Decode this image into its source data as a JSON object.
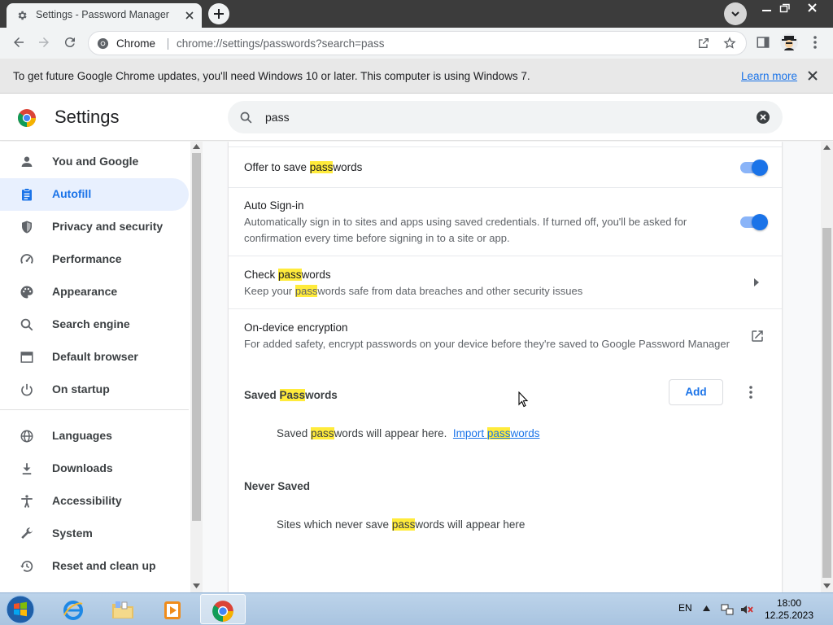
{
  "tab": {
    "title": "Settings - Password Manager"
  },
  "omnibox": {
    "site_name": "Chrome",
    "url": "chrome://settings/passwords?search=pass"
  },
  "infobar": {
    "message": "To get future Google Chrome updates, you'll need Windows 10 or later. This computer is using Windows 7.",
    "learn_more": "Learn more"
  },
  "header": {
    "title": "Settings",
    "search_query": "pass"
  },
  "sidebar": {
    "items": [
      {
        "label": "You and Google",
        "icon": "person-icon"
      },
      {
        "label": "Autofill",
        "icon": "clipboard-icon",
        "active": true
      },
      {
        "label": "Privacy and security",
        "icon": "shield-icon"
      },
      {
        "label": "Performance",
        "icon": "speedometer-icon"
      },
      {
        "label": "Appearance",
        "icon": "palette-icon"
      },
      {
        "label": "Search engine",
        "icon": "search-icon"
      },
      {
        "label": "Default browser",
        "icon": "browser-icon"
      },
      {
        "label": "On startup",
        "icon": "power-icon"
      },
      {
        "label": "Languages",
        "icon": "globe-icon"
      },
      {
        "label": "Downloads",
        "icon": "download-icon"
      },
      {
        "label": "Accessibility",
        "icon": "accessibility-icon"
      },
      {
        "label": "System",
        "icon": "wrench-icon"
      },
      {
        "label": "Reset and clean up",
        "icon": "history-icon"
      }
    ]
  },
  "content": {
    "offer_save": {
      "pre": "Offer to save ",
      "hl": "pass",
      "post": "words",
      "enabled": true
    },
    "auto_signin": {
      "title": "Auto Sign-in",
      "description": "Automatically sign in to sites and apps using saved credentials. If turned off, you'll be asked for confirmation every time before signing in to a site or app.",
      "enabled": true
    },
    "check_passwords": {
      "title_pre": "Check ",
      "title_hl": "pass",
      "title_post": "words",
      "desc_pre": "Keep your ",
      "desc_hl": "pass",
      "desc_post": "words safe from data breaches and other security issues"
    },
    "encryption": {
      "title": "On-device encryption",
      "description": "For added safety, encrypt passwords on your device before they're saved to Google Password Manager"
    },
    "saved_passwords": {
      "heading_pre": "Saved ",
      "heading_hl": "Pass",
      "heading_post": "words",
      "add_label": "Add",
      "empty_pre": "Saved ",
      "empty_hl": "pass",
      "empty_post": "words will appear here.",
      "import_pre": "Import ",
      "import_hl": "pass",
      "import_post": "words"
    },
    "never_saved": {
      "heading": "Never Saved",
      "empty_pre": "Sites which never save ",
      "empty_hl": "pass",
      "empty_post": "words will appear here"
    }
  },
  "taskbar": {
    "language": "EN",
    "time": "18:00",
    "date": "12.25.2023"
  },
  "colors": {
    "accent": "#1a73e8",
    "highlight": "#ffeb3b",
    "active_bg": "#e8f0fe"
  }
}
